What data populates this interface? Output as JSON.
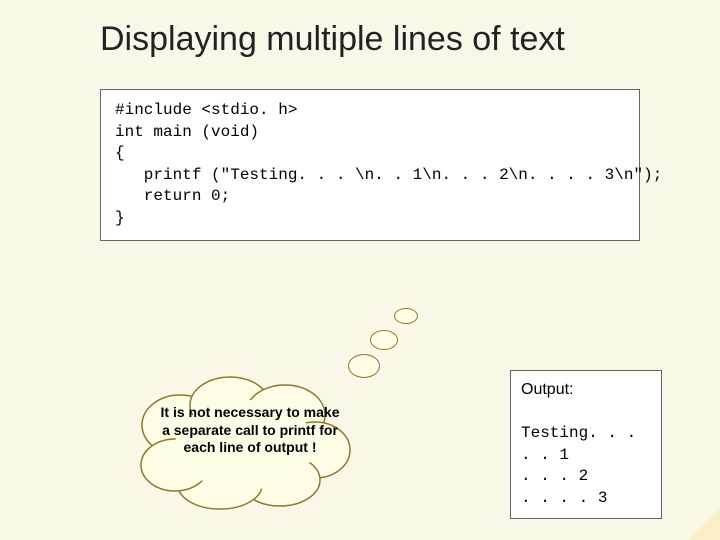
{
  "title": "Displaying multiple lines of text",
  "code": "#include <stdio. h>\nint main (void)\n{\n   printf (\"Testing. . . \\n. . 1\\n. . . 2\\n. . . . 3\\n\");\n   return 0;\n}",
  "cloud_text": "It is not necessary to make a separate call to printf for each line of output !",
  "output": {
    "label": "Output:",
    "text": "Testing. . .\n. . 1\n. . . 2\n. . . . 3"
  }
}
